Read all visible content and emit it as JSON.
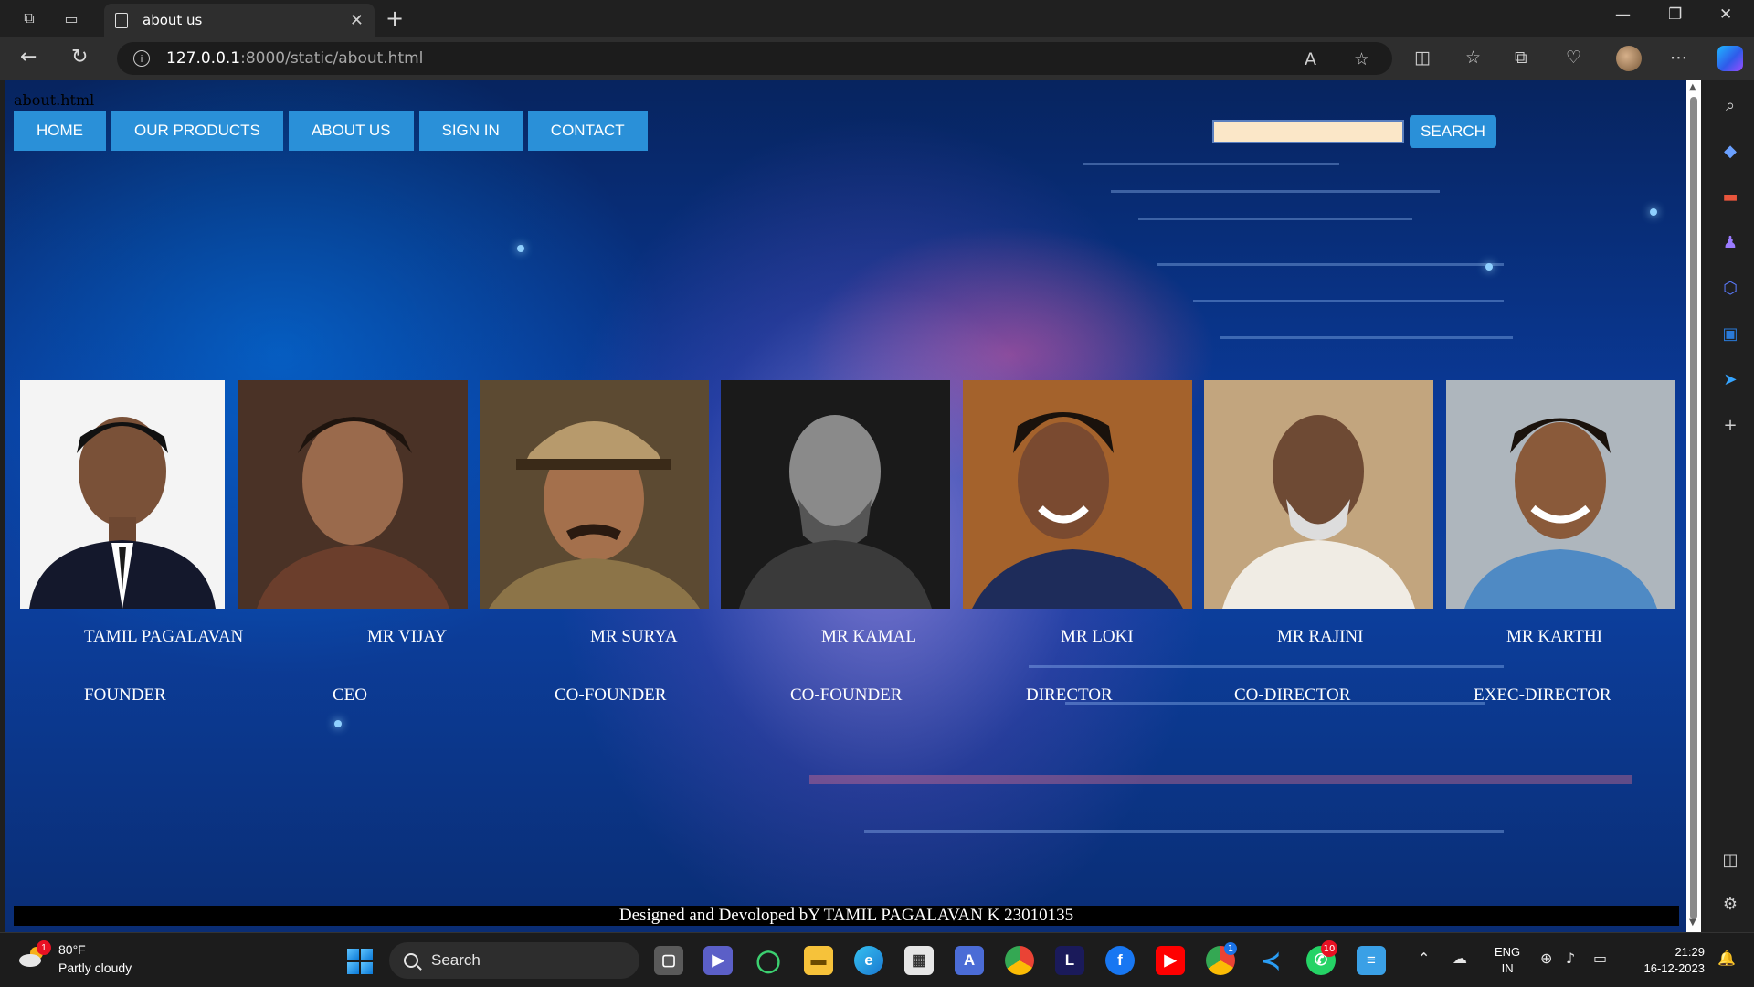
{
  "browser": {
    "tab_title": "about us",
    "url_host": "127.0.0.1",
    "url_path": ":8000/static/about.html"
  },
  "page": {
    "file_label": "about.html",
    "nav": [
      "HOME",
      "OUR PRODUCTS",
      "ABOUT US",
      "SIGN IN",
      "CONTACT"
    ],
    "search_button": "SEARCH",
    "search_value": "",
    "team": [
      {
        "name": "TAMIL PAGALAVAN",
        "role": "FOUNDER"
      },
      {
        "name": "MR VIJAY",
        "role": "CEO"
      },
      {
        "name": "MR SURYA",
        "role": "CO-FOUNDER"
      },
      {
        "name": "MR KAMAL",
        "role": "CO-FOUNDER"
      },
      {
        "name": "MR LOKI",
        "role": "DIRECTOR"
      },
      {
        "name": "MR RAJINI",
        "role": "CO-DIRECTOR"
      },
      {
        "name": "MR KARTHI",
        "role": "EXEC-DIRECTOR"
      }
    ],
    "footer": "Designed and Devoloped bY TAMIL PAGALAVAN K 23010135"
  },
  "taskbar": {
    "weather_temp": "80°F",
    "weather_cond": "Partly cloudy",
    "weather_badge": "1",
    "search_label": "Search",
    "chrome_badge": "1",
    "whatsapp_badge": "10",
    "lang_top": "ENG",
    "lang_bottom": "IN",
    "time": "21:29",
    "date": "16-12-2023"
  },
  "colors": {
    "nav_button": "#2a90d8",
    "search_input": "#fbe7c8",
    "footer_bg": "#000000"
  }
}
